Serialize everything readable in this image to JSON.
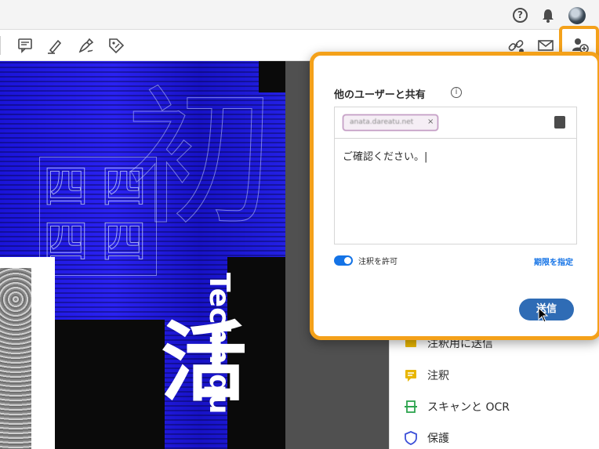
{
  "appbar": {
    "help_icon": "?",
    "icons": [
      "help-icon",
      "bell-icon",
      "avatar"
    ]
  },
  "toolbar": {
    "tools": [
      "comment-icon",
      "highlight-pen-icon",
      "sign-pen-icon",
      "stamp-tag-icon"
    ],
    "right_tools": [
      "link-icon",
      "mail-icon",
      "share-user-icon"
    ]
  },
  "document": {
    "vertical_text": "Techniqu",
    "white_kanji": "活"
  },
  "share_dialog": {
    "title": "他のユーザーと共有",
    "info_icon": "i",
    "recipient_chip": "anata.dareatu.net",
    "chip_remove": "×",
    "message": "ご確認ください。|",
    "allow_comments_label": "注釈を許可",
    "allow_comments_enabled": true,
    "set_expiry_link": "期限を指定",
    "send_button": "送信",
    "accent_color": "#f4a11a",
    "primary_color": "#2f6cb5"
  },
  "right_panel": {
    "items": [
      {
        "label": "注釈用に送信",
        "icon": "send-for-comment-icon",
        "color": "#e8b600"
      },
      {
        "label": "注釈",
        "icon": "comment-icon",
        "color": "#e8b600"
      },
      {
        "label": "スキャンと OCR",
        "icon": "scan-ocr-icon",
        "color": "#2da44e"
      },
      {
        "label": "保護",
        "icon": "protect-shield-icon",
        "color": "#3b4fd8"
      }
    ]
  }
}
